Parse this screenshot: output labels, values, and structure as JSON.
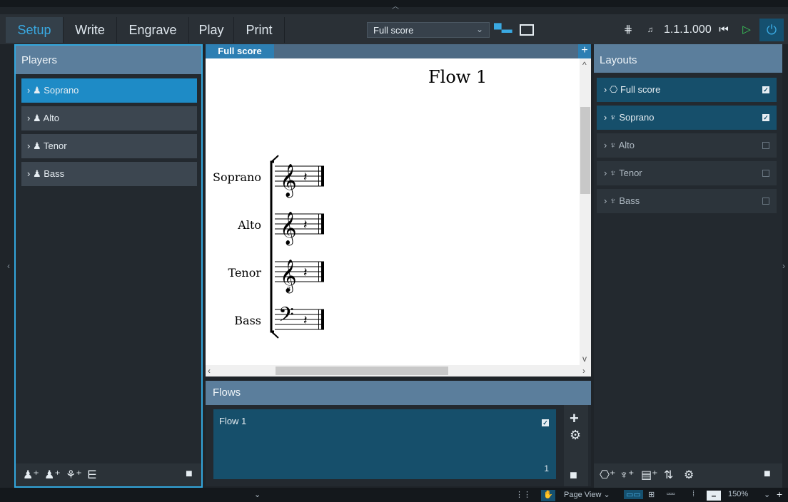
{
  "modes": [
    "Setup",
    "Write",
    "Engrave",
    "Play",
    "Print"
  ],
  "active_mode": "Setup",
  "toolbar": {
    "layout_select": "Full score",
    "position_readout": "1.1.1.000"
  },
  "players_panel": {
    "title": "Players",
    "players": [
      {
        "label": "Soprano",
        "selected": true
      },
      {
        "label": "Alto",
        "selected": false
      },
      {
        "label": "Tenor",
        "selected": false
      },
      {
        "label": "Bass",
        "selected": false
      }
    ]
  },
  "score": {
    "tab_label": "Full score",
    "flow_title": "Flow 1",
    "staves": [
      "Soprano",
      "Alto",
      "Tenor",
      "Bass"
    ]
  },
  "flows_panel": {
    "title": "Flows",
    "flows": [
      {
        "name": "Flow 1",
        "number": "1",
        "checked": true
      }
    ]
  },
  "layouts_panel": {
    "title": "Layouts",
    "layouts": [
      {
        "label": "Full score",
        "checked": true
      },
      {
        "label": "Soprano",
        "checked": true
      },
      {
        "label": "Alto",
        "checked": false
      },
      {
        "label": "Tenor",
        "checked": false
      },
      {
        "label": "Bass",
        "checked": false
      }
    ]
  },
  "statusbar": {
    "view_mode": "Page View",
    "zoom": "150%"
  },
  "colors": {
    "accent": "#33a6dc",
    "panel_header": "#5b7e9c",
    "active_row": "#164f6b"
  }
}
